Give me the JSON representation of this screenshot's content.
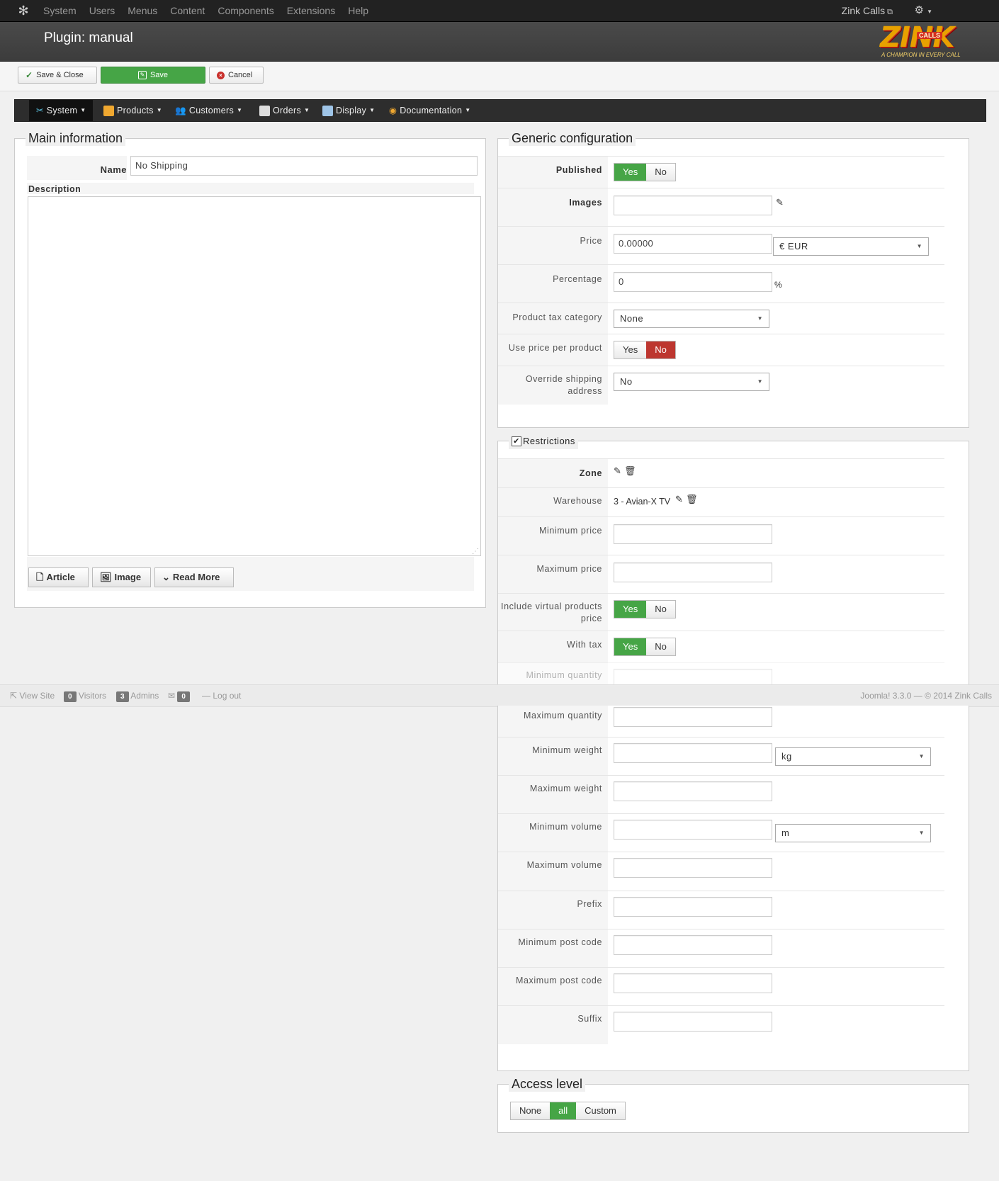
{
  "topnav": {
    "items": [
      "System",
      "Users",
      "Menus",
      "Content",
      "Components",
      "Extensions",
      "Help"
    ],
    "site_name": "Zink Calls"
  },
  "header": {
    "title": "Plugin: manual",
    "brand_text": "ZINK",
    "brand_badge": "CALLS",
    "brand_tagline": "A CHAMPION IN EVERY CALL"
  },
  "toolbar": {
    "save_close": "Save & Close",
    "save": "Save",
    "cancel": "Cancel"
  },
  "hikamenu": {
    "items": [
      "System",
      "Products",
      "Customers",
      "Orders",
      "Display",
      "Documentation"
    ]
  },
  "main_info": {
    "legend": "Main information",
    "name_label": "Name",
    "name_value": "No Shipping",
    "description_label": "Description",
    "editor_buttons": [
      "Article",
      "Image",
      "Read More"
    ]
  },
  "generic": {
    "legend": "Generic configuration",
    "published_label": "Published",
    "images_label": "Images",
    "price_label": "Price",
    "price_value": "0.00000",
    "currency": "€ EUR",
    "percentage_label": "Percentage",
    "percentage_value": "0",
    "percent_sign": "%",
    "tax_label": "Product tax category",
    "tax_value": "None",
    "price_per_product_label": "Use price per product",
    "override_label": "Override shipping address",
    "override_value": "No",
    "yes": "Yes",
    "no": "No"
  },
  "restrictions": {
    "legend": "Restrictions",
    "zone_label": "Zone",
    "warehouse_label": "Warehouse",
    "warehouse_value": "3 - Avian-X TV",
    "min_price_label": "Minimum price",
    "max_price_label": "Maximum price",
    "include_virtual_label": "Include virtual products price",
    "with_tax_label": "With tax",
    "min_qty_label": "Minimum quantity",
    "max_qty_label": "Maximum quantity",
    "min_weight_label": "Minimum weight",
    "weight_unit": "kg",
    "max_weight_label": "Maximum weight",
    "min_volume_label": "Minimum volume",
    "volume_unit": "m",
    "max_volume_label": "Maximum volume",
    "prefix_label": "Prefix",
    "min_postcode_label": "Minimum post code",
    "max_postcode_label": "Maximum post code",
    "suffix_label": "Suffix"
  },
  "access": {
    "legend": "Access level",
    "options": [
      "None",
      "all",
      "Custom"
    ]
  },
  "statusbar": {
    "view_site": "View Site",
    "visitors_count": "0",
    "visitors": "Visitors",
    "admins_count": "3",
    "admins": "Admins",
    "messages_count": "0",
    "logout": "Log out",
    "version": "Joomla! 3.3.0  —  © 2014 Zink Calls"
  },
  "colors": {
    "accent_green": "#46a546",
    "accent_red": "#bd362f",
    "nav_dark": "#222222"
  }
}
